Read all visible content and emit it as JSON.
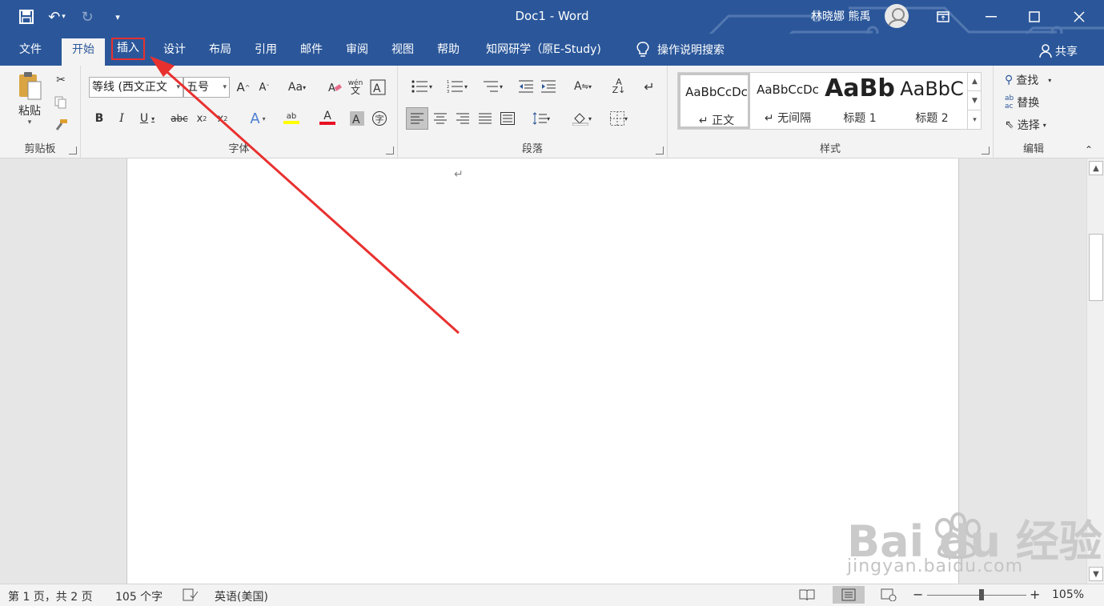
{
  "window": {
    "doc_name": "Doc1",
    "separator": "-",
    "app_name": "Word",
    "user_name": "林晓娜 熊禹"
  },
  "tabs": [
    {
      "label": "文件"
    },
    {
      "label": "开始"
    },
    {
      "label": "插入"
    },
    {
      "label": "设计"
    },
    {
      "label": "布局"
    },
    {
      "label": "引用"
    },
    {
      "label": "邮件"
    },
    {
      "label": "审阅"
    },
    {
      "label": "视图"
    },
    {
      "label": "帮助"
    },
    {
      "label": "知网研学（原E-Study)"
    }
  ],
  "tell_me": "操作说明搜索",
  "share": "共享",
  "ribbon": {
    "clipboard": {
      "label": "剪贴板",
      "paste": "粘贴"
    },
    "font": {
      "label": "字体",
      "font_name": "等线 (西文正文",
      "font_size": "五号"
    },
    "paragraph": {
      "label": "段落"
    },
    "styles": {
      "label": "样式",
      "items": [
        {
          "sample": "AaBbCcDc",
          "name": "↵ 正文"
        },
        {
          "sample": "AaBbCcDc",
          "name": "↵ 无间隔"
        },
        {
          "sample": "AaBb",
          "name": "标题 1"
        },
        {
          "sample": "AaBbC",
          "name": "标题 2"
        }
      ]
    },
    "editing": {
      "label": "编辑",
      "find": "查找",
      "replace": "替换",
      "select": "选择"
    }
  },
  "document": {
    "para_mark": "↵"
  },
  "status": {
    "page": "第 1 页，共 2 页",
    "words": "105 个字",
    "language": "英语(美国)",
    "zoom": "105%",
    "zoom_level": 0.55
  },
  "watermark": {
    "logo": "Bai du 经验",
    "url": "jingyan.baidu.com"
  }
}
